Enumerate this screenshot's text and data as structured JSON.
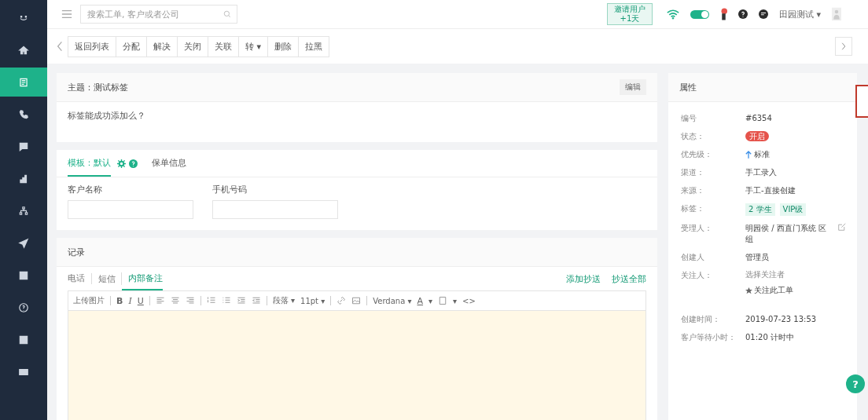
{
  "sidebar": {
    "items": [
      {
        "selected": false
      },
      {
        "selected": false
      },
      {
        "selected": true
      },
      {
        "selected": false
      },
      {
        "selected": false
      },
      {
        "selected": false
      },
      {
        "selected": false
      },
      {
        "selected": false
      },
      {
        "selected": false
      },
      {
        "selected": false
      },
      {
        "selected": false
      },
      {
        "selected": false
      }
    ]
  },
  "header": {
    "search": {
      "placeholder": "搜索工单, 客户或者公司"
    },
    "promo": [
      "邀请用户",
      "+1天"
    ],
    "toggle_on": true,
    "user": "田园测试 ▾"
  },
  "toolbar": {
    "buttons": [
      "返回列表",
      "分配",
      "解决",
      "关闭",
      "关联",
      "转 ▾",
      "删除",
      "拉黑"
    ]
  },
  "subject": {
    "title": "主题：测试标签",
    "edit": "编辑",
    "description": "标签能成功添加么？"
  },
  "form": {
    "tabs": [
      {
        "label": "模板：默认",
        "selected": true
      },
      {
        "label": "保单信息",
        "selected": false
      }
    ],
    "fields": [
      {
        "label": "客户名称"
      },
      {
        "label": "手机号码"
      }
    ]
  },
  "records": {
    "title": "记录",
    "tabs": [
      {
        "label": "电话",
        "selected": false
      },
      {
        "label": "短信",
        "selected": false
      },
      {
        "label": "内部备注",
        "selected": true
      }
    ],
    "links": [
      "添加抄送",
      "抄送全部"
    ],
    "editor_toolbar": [
      {
        "kind": "text",
        "label": "上传图片"
      },
      {
        "kind": "sep"
      },
      {
        "kind": "bold",
        "label": "B"
      },
      {
        "kind": "italic",
        "label": "I"
      },
      {
        "kind": "underline",
        "label": "U"
      },
      {
        "kind": "sep"
      },
      {
        "kind": "alignleft"
      },
      {
        "kind": "aligncenter"
      },
      {
        "kind": "alignright"
      },
      {
        "kind": "sep"
      },
      {
        "kind": "numbered"
      },
      {
        "kind": "bulleted"
      },
      {
        "kind": "indent"
      },
      {
        "kind": "outdent"
      },
      {
        "kind": "sep"
      },
      {
        "kind": "text",
        "label": "段落 ▾"
      },
      {
        "kind": "text",
        "label": "11pt ▾"
      },
      {
        "kind": "sep"
      },
      {
        "kind": "link"
      },
      {
        "kind": "image"
      },
      {
        "kind": "sep"
      },
      {
        "kind": "text",
        "label": "Verdana ▾"
      },
      {
        "kind": "fontcolor",
        "label": "A"
      },
      {
        "kind": "text",
        "label": "▾"
      },
      {
        "kind": "fill"
      },
      {
        "kind": "text",
        "label": "▾"
      },
      {
        "kind": "text",
        "label": "<>"
      }
    ]
  },
  "properties": {
    "title": "属性",
    "rows": [
      {
        "label": "编号",
        "kind": "text",
        "value": "#6354"
      },
      {
        "label": "状态：",
        "kind": "badge",
        "value": "开启",
        "color": "#e5534b"
      },
      {
        "label": "优先级：",
        "kind": "priority",
        "value": "标准"
      },
      {
        "label": "渠道：",
        "kind": "text",
        "value": "手工录入"
      },
      {
        "label": "来源：",
        "kind": "text",
        "value": "手工-直接创建"
      },
      {
        "label": "标签：",
        "kind": "tags",
        "tags": [
          "2 学生",
          "VIP级"
        ]
      },
      {
        "label": "受理人：",
        "kind": "assignee",
        "value": "明园侯 / 西直门系统 区组"
      },
      {
        "label": "创建人",
        "kind": "text",
        "value": "管理员"
      },
      {
        "label": "关注人：",
        "kind": "followers",
        "placeholder": "选择关注者",
        "action": "关注此工单"
      },
      {
        "label": "创建时间：",
        "kind": "text",
        "value": "2019-07-23 13:53"
      },
      {
        "label": "客户等待小时：",
        "kind": "text",
        "value": "01:20 计时中"
      }
    ]
  },
  "help_button": "?"
}
